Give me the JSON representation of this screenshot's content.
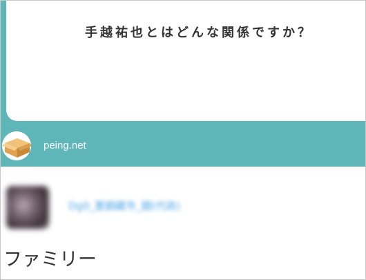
{
  "card": {
    "question": "手越祐也とはどんな関係ですか？",
    "brand_name": "peing.net",
    "brand_icon": "cardboard-box-icon",
    "background_color": "#5fb6b8"
  },
  "user": {
    "name": "Dg0_置鋼藏市_闘(代政)"
  },
  "section": {
    "title": "ファミリー"
  }
}
